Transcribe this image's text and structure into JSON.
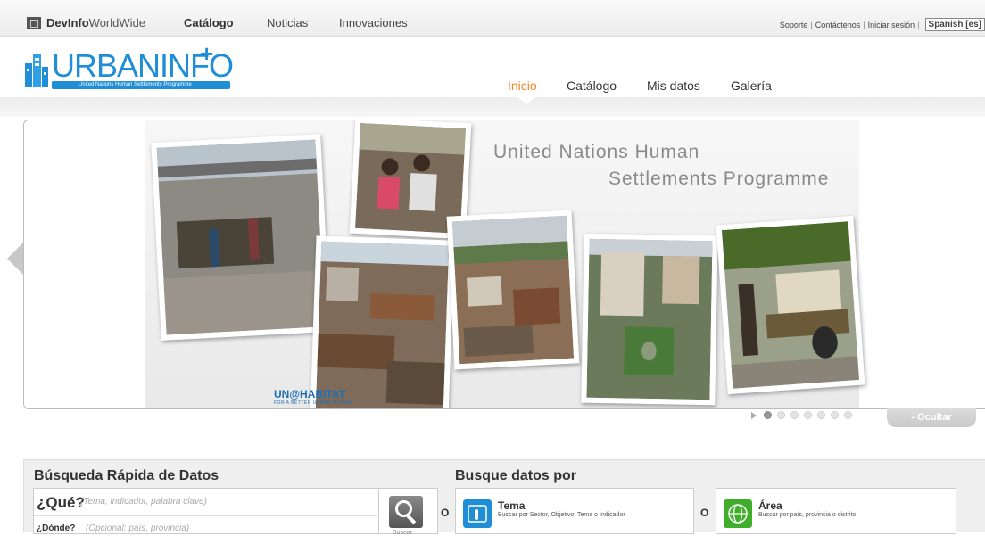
{
  "topbar": {
    "brand_bold": "DevInfo",
    "brand_rest": "WorldWide",
    "nav": [
      "Catálogo",
      "Noticias",
      "Innovaciones"
    ],
    "links": [
      "Soporte",
      "Contáctenos",
      "Iniciar sesión"
    ],
    "separator": "|",
    "language": "Spanish [es]"
  },
  "header": {
    "logo_word": "URBANINFO",
    "logo_tagline": "United Nations Human Settlements Programme",
    "nav": [
      "Inicio",
      "Catálogo",
      "Mis datos",
      "Galería"
    ],
    "active_nav": "Inicio"
  },
  "banner": {
    "title_line1": "United Nations Human",
    "title_line2": "Settlements Programme",
    "unhabitat": "UN@HABITAT",
    "unhabitat_sub": "FOR A BETTER URBAN FUTURE",
    "slides_total": 7,
    "slide_active": 1,
    "hide_label": "- Ocultar"
  },
  "quick_search": {
    "title": "Búsqueda Rápida de Datos",
    "what_label": "¿Qué?",
    "what_placeholder": "(Tema, indicador, palabra clave)",
    "where_label": "¿Dónde?",
    "where_placeholder": "(Opcional: país, provincia)",
    "button_label": "Buscar"
  },
  "browse": {
    "title": "Busque datos por",
    "or_label": "O",
    "cards": [
      {
        "title": "Tema",
        "desc": "Buscar por Sector, Objetivo, Tema o Indicador",
        "icon": "touch-icon"
      },
      {
        "title": "Área",
        "desc": "Buscar por país, provincia o distrito",
        "icon": "globe-icon"
      }
    ]
  },
  "colors": {
    "accent_blue": "#1f8ed6",
    "active_nav": "#f08a24"
  }
}
